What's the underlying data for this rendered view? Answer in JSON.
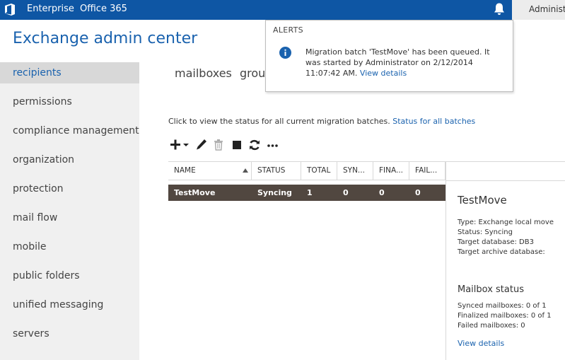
{
  "topbar": {
    "enterprise_label": "Enterprise",
    "office365_label": "Office 365",
    "user_label": "Administrator",
    "bar_color": "#0e56a4"
  },
  "app": {
    "title": "Exchange admin center"
  },
  "sidebar": {
    "items": [
      {
        "label": "recipients",
        "active": true
      },
      {
        "label": "permissions"
      },
      {
        "label": "compliance management"
      },
      {
        "label": "organization"
      },
      {
        "label": "protection"
      },
      {
        "label": "mail flow"
      },
      {
        "label": "mobile"
      },
      {
        "label": "public folders"
      },
      {
        "label": "unified messaging"
      },
      {
        "label": "servers"
      }
    ]
  },
  "tabs": [
    {
      "label": "mailboxes"
    },
    {
      "label": "groups"
    }
  ],
  "migration": {
    "instruction": "Click to view the status for all current migration batches.",
    "status_link": "Status for all batches",
    "toolbar_icons": [
      "add-icon",
      "edit-icon",
      "delete-icon",
      "stop-icon",
      "refresh-icon",
      "more-icon"
    ],
    "columns": [
      "NAME",
      "STATUS",
      "TOTAL",
      "SYN...",
      "FINA...",
      "FAIL..."
    ],
    "rows": [
      {
        "name": "TestMove",
        "status": "Syncing",
        "total": "1",
        "synced": "0",
        "finalized": "0",
        "failed": "0"
      }
    ]
  },
  "details": {
    "title": "TestMove",
    "type": "Type: Exchange local move",
    "status": "Status: Syncing",
    "target_db": "Target database: DB3",
    "target_archive_db": "Target archive database:",
    "mailbox_status_heading": "Mailbox status",
    "synced": "Synced mailboxes: 0 of 1",
    "finalized": "Finalized mailboxes: 0 of 1",
    "failed": "Failed mailboxes: 0",
    "view_details": "View details"
  },
  "alerts": {
    "title": "ALERTS",
    "message": "Migration batch 'TestMove' has been queued. It was started by Administrator on 2/12/2014 11:07:42 AM.",
    "link": "View details"
  }
}
